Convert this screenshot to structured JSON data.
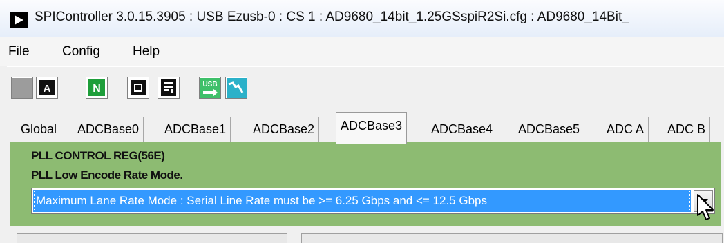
{
  "window": {
    "title": "SPIController 3.0.15.3905 : USB Ezusb-0 : CS 1 : AD9680_14bit_1.25GSspiR2Si.cfg : AD9680_14Bit_"
  },
  "menu": {
    "items": [
      "File",
      "Config",
      "Help"
    ]
  },
  "toolbar": {
    "buttons": [
      "blank-icon",
      "a-chip-icon",
      "n-icon",
      "chip-icon",
      "register-icon",
      "usb-icon",
      "scope-icon"
    ],
    "usb_text": "USB",
    "a_text": "A",
    "n_text": "N"
  },
  "tabs": {
    "items": [
      "Global",
      "ADCBase0",
      "ADCBase1",
      "ADCBase2",
      "ADCBase3",
      "ADCBase4",
      "ADCBase5",
      "ADC A",
      "ADC B"
    ],
    "selected": "ADCBase3"
  },
  "panel": {
    "register_title": "PLL CONTROL REG(56E)",
    "field_title": "PLL Low Encode Rate Mode.",
    "dropdown_value": "Maximum Lane Rate Mode : Serial Line Rate must be >= 6.25 Gbps and <= 12.5 Gbps",
    "panel_color": "#8dbb72",
    "highlight_color": "#3399ff"
  }
}
